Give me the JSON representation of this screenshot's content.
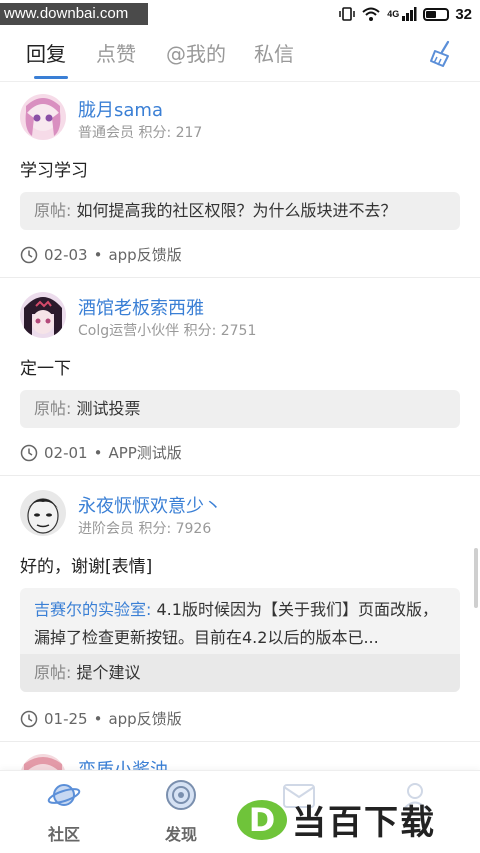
{
  "status_bar": {
    "watermark": "www.downbai.com",
    "network": "4G",
    "battery": "32"
  },
  "tabs": [
    {
      "label": "回复",
      "active": true
    },
    {
      "label": "点赞",
      "active": false
    },
    {
      "label": "@我的",
      "active": false
    },
    {
      "label": "私信",
      "active": false
    }
  ],
  "posts": [
    {
      "username": "胧月sama",
      "meta": "普通会员 积分: 217",
      "content": "学习学习",
      "quote_label": "原帖:",
      "quote_text": "如何提高我的社区权限？为什么版块进不去？",
      "date": "02-03",
      "board": "app反馈版"
    },
    {
      "username": "酒馆老板索西雅",
      "meta": "Colg运营小伙伴 积分: 2751",
      "content": "定一下",
      "quote_label": "原帖:",
      "quote_text": "测试投票",
      "date": "02-01",
      "board": "APP测试版"
    },
    {
      "username": "永夜恹恹欢意少丶",
      "meta": "进阶会员 积分: 7926",
      "content": "好的，谢谢[表情]",
      "reply_from": "吉赛尔的实验室:",
      "reply_text": "4.1版时候因为【关于我们】页面改版，漏掉了检查更新按钮。目前在4.2以后的版本已...",
      "quote_label": "原帖:",
      "quote_text": "提个建议",
      "date": "01-25",
      "board": "app反馈版"
    },
    {
      "username": "变质小酱油"
    }
  ],
  "bottom_nav": [
    {
      "label": "社区",
      "icon": "planet-icon"
    },
    {
      "label": "发现",
      "icon": "compass-icon"
    }
  ],
  "brand": {
    "logo_letter": "D",
    "text": "当百下载"
  },
  "colors": {
    "accent": "#3a7fd5",
    "brand_green": "#6fc43a"
  }
}
